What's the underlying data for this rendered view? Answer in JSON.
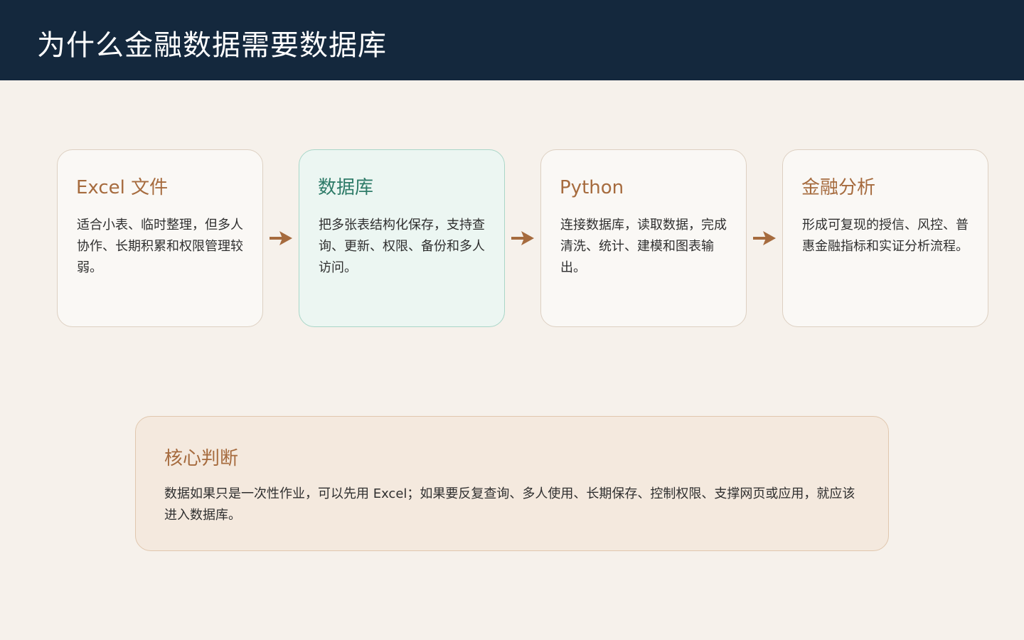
{
  "header": {
    "title": "为什么金融数据需要数据库"
  },
  "colors": {
    "header_bg": "#14283D",
    "page_bg": "#F6F1EB",
    "accent_brown": "#A66B3E",
    "accent_green": "#2E7B68",
    "highlight_bg": "#ECF6F2"
  },
  "flow": {
    "steps": [
      {
        "title": "Excel 文件",
        "body": "适合小表、临时整理，但多人协作、长期积累和权限管理较弱。"
      },
      {
        "title": "数据库",
        "body": "把多张表结构化保存，支持查询、更新、权限、备份和多人访问。"
      },
      {
        "title": "Python",
        "body": "连接数据库，读取数据，完成清洗、统计、建模和图表输出。"
      },
      {
        "title": "金融分析",
        "body": "形成可复现的授信、风控、普惠金融指标和实证分析流程。"
      }
    ],
    "arrow_icon": "arrow-right-icon"
  },
  "summary": {
    "title": "核心判断",
    "body": "数据如果只是一次性作业，可以先用 Excel；如果要反复查询、多人使用、长期保存、控制权限、支撑网页或应用，就应该进入数据库。"
  }
}
